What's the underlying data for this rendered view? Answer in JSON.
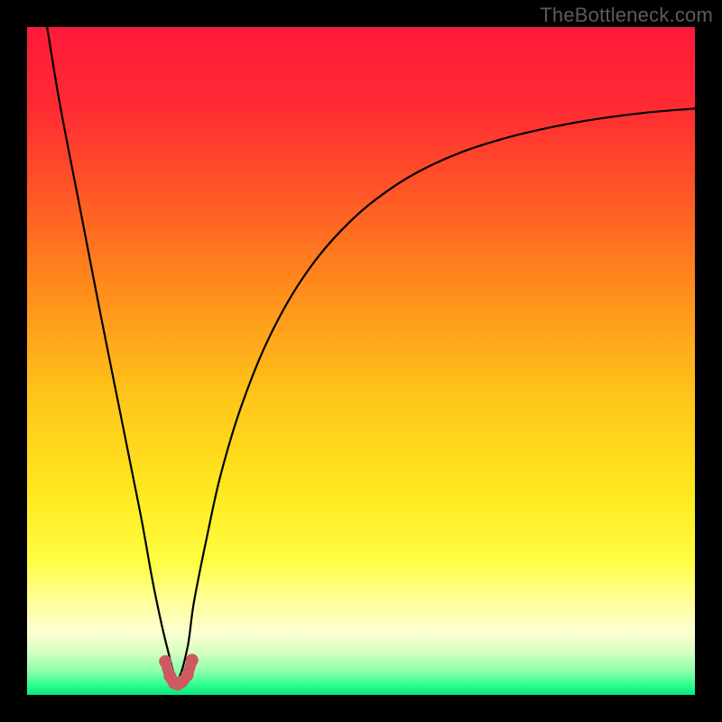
{
  "watermark": "TheBottleneck.com",
  "chart_data": {
    "type": "line",
    "title": "",
    "xlabel": "",
    "ylabel": "",
    "xlim": [
      0,
      100
    ],
    "ylim": [
      0,
      100
    ],
    "legend": false,
    "grid": false,
    "background_gradient": {
      "direction": "vertical",
      "stops": [
        {
          "pos": 0.0,
          "color": "#ff1a3a"
        },
        {
          "pos": 0.12,
          "color": "#ff2b33"
        },
        {
          "pos": 0.25,
          "color": "#ff5726"
        },
        {
          "pos": 0.4,
          "color": "#ff8f1c"
        },
        {
          "pos": 0.55,
          "color": "#ffc41a"
        },
        {
          "pos": 0.7,
          "color": "#ffe91f"
        },
        {
          "pos": 0.8,
          "color": "#fffd42"
        },
        {
          "pos": 0.86,
          "color": "#ffff9a"
        },
        {
          "pos": 0.905,
          "color": "#fdffd0"
        },
        {
          "pos": 0.935,
          "color": "#d8ffc2"
        },
        {
          "pos": 0.965,
          "color": "#8cffac"
        },
        {
          "pos": 0.985,
          "color": "#2eff8f"
        },
        {
          "pos": 1.0,
          "color": "#08e77a"
        }
      ]
    },
    "series": [
      {
        "name": "bottleneck-curve",
        "stroke": "#000000",
        "stroke_width": 2.2,
        "x": [
          3,
          5,
          8,
          11,
          14,
          17,
          19,
          21,
          22.5,
          24,
          25,
          27,
          29,
          32,
          36,
          41,
          47,
          54,
          62,
          71,
          81,
          91,
          100
        ],
        "y": [
          100,
          88,
          72.5,
          57,
          42,
          27,
          16,
          7,
          2.5,
          7,
          14,
          24,
          33,
          43,
          53,
          62,
          69.5,
          75.5,
          80,
          83.2,
          85.5,
          87,
          87.8
        ]
      },
      {
        "name": "bottleneck-marker-dots",
        "type": "scatter",
        "stroke": "#cc5a61",
        "marker_radius_px": 7,
        "x": [
          20.7,
          21.4,
          22.0,
          22.6,
          23.2,
          24.0,
          24.7
        ],
        "y": [
          5.0,
          2.8,
          1.8,
          1.6,
          2.0,
          3.0,
          5.2
        ]
      },
      {
        "name": "bottleneck-marker-connector",
        "stroke": "#cc5a61",
        "stroke_width": 12,
        "x": [
          20.7,
          21.4,
          22.0,
          22.6,
          23.2,
          24.0,
          24.7
        ],
        "y": [
          5.0,
          2.8,
          1.8,
          1.6,
          2.0,
          3.0,
          5.2
        ]
      }
    ]
  }
}
